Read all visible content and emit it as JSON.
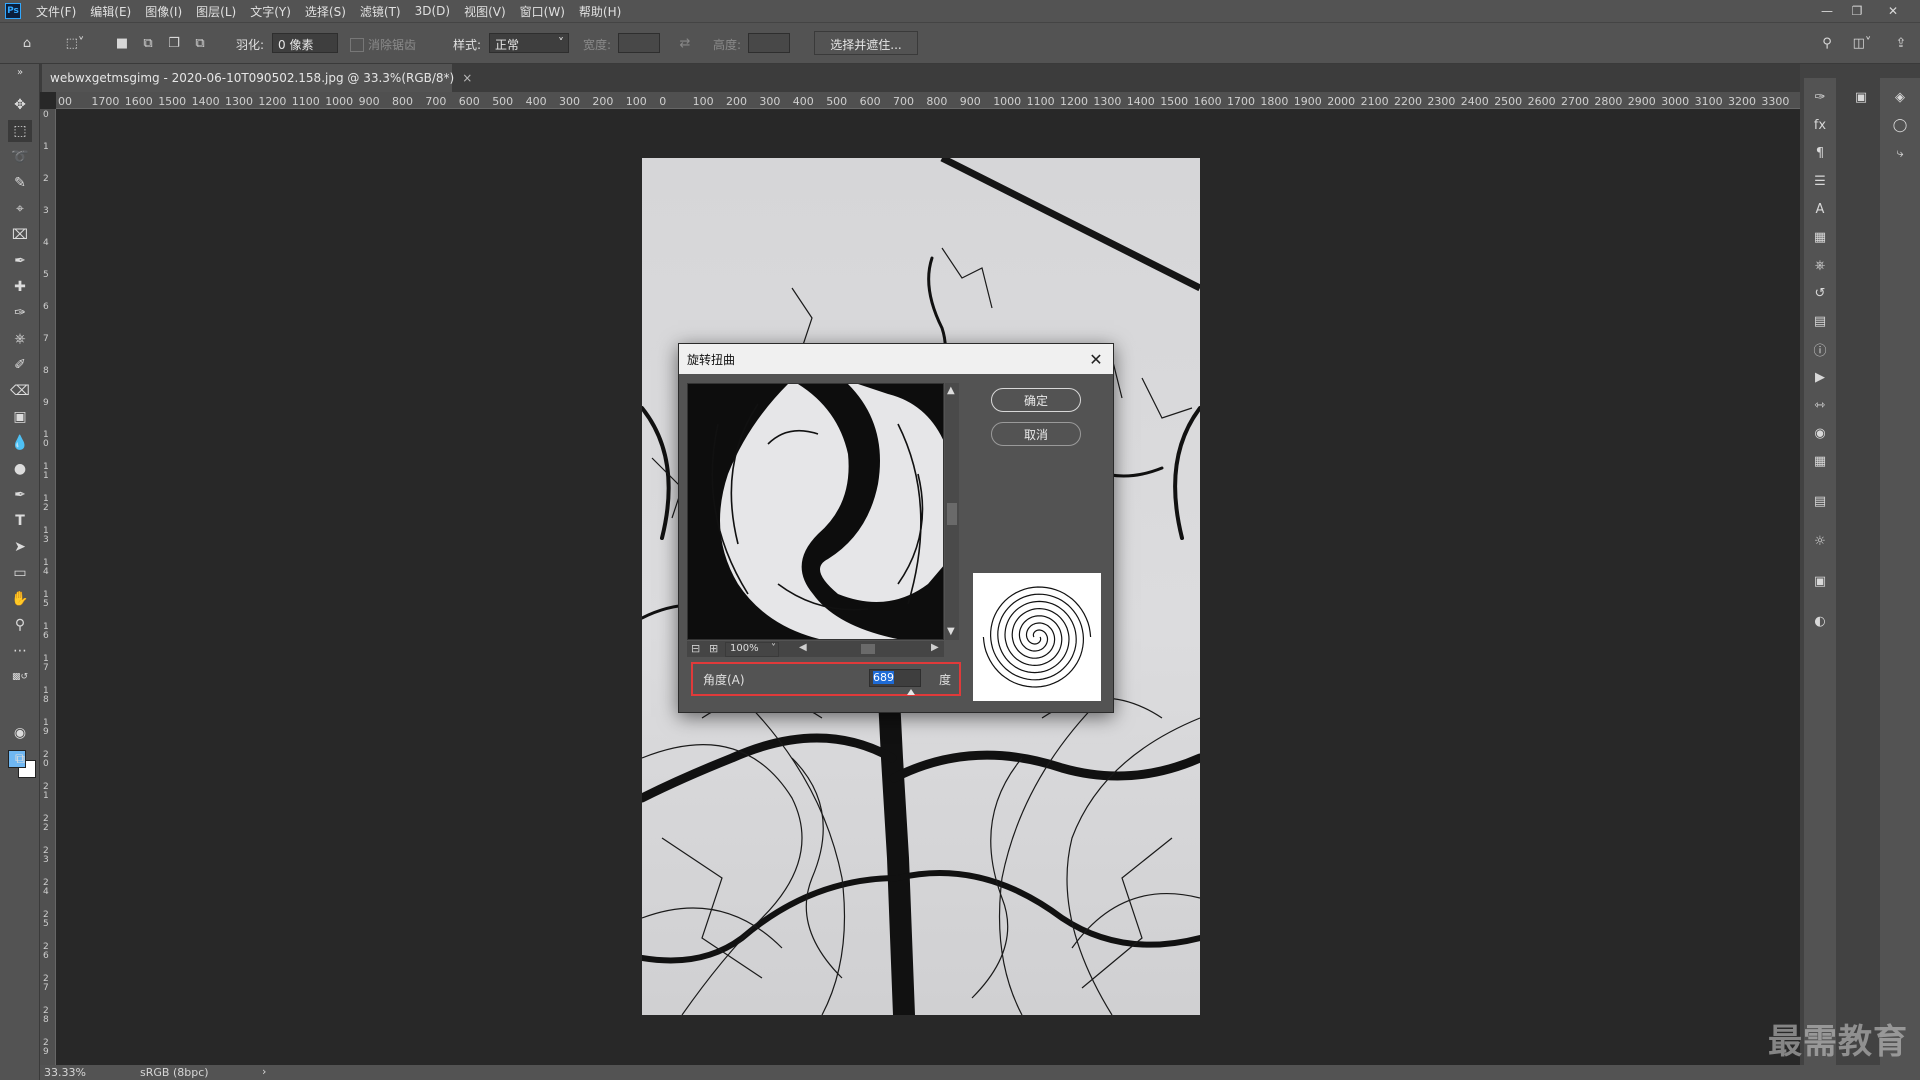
{
  "menubar": {
    "logo": "Ps",
    "items": [
      "文件(F)",
      "编辑(E)",
      "图像(I)",
      "图层(L)",
      "文字(Y)",
      "选择(S)",
      "滤镜(T)",
      "3D(D)",
      "视图(V)",
      "窗口(W)",
      "帮助(H)"
    ]
  },
  "optionsbar": {
    "feather_label": "羽化:",
    "feather_value": "0 像素",
    "antialias_label": "消除锯齿",
    "style_label": "样式:",
    "style_value": "正常",
    "width_label": "宽度:",
    "height_label": "高度:",
    "select_mask_label": "选择并遮住..."
  },
  "document": {
    "tab_title": "webwxgetmsgimg - 2020-06-10T090502.158.jpg @ 33.3%(RGB/8*)",
    "tab_close": "×"
  },
  "ruler": {
    "h_ticks": [
      "00",
      "1700",
      "1600",
      "1500",
      "1400",
      "1300",
      "1200",
      "1100",
      "1000",
      "900",
      "800",
      "700",
      "600",
      "500",
      "400",
      "300",
      "200",
      "100",
      "0",
      "100",
      "200",
      "300",
      "400",
      "500",
      "600",
      "700",
      "800",
      "900",
      "1000",
      "1100",
      "1200",
      "1300",
      "1400",
      "1500",
      "1600",
      "1700",
      "1800",
      "1900",
      "2000",
      "2100",
      "2200",
      "2300",
      "2400",
      "2500",
      "2600",
      "2700",
      "2800",
      "2900",
      "3000",
      "3100",
      "3200",
      "3300"
    ],
    "v_ticks": [
      "0",
      "1",
      "2",
      "3",
      "4",
      "5",
      "6",
      "7",
      "8",
      "9",
      "1 0",
      "1 1",
      "1 2",
      "1 3",
      "1 4",
      "1 5",
      "1 6",
      "1 7",
      "1 8",
      "1 9",
      "2 0",
      "2 1",
      "2 2",
      "2 3",
      "2 4",
      "2 5",
      "2 6",
      "2 7",
      "2 8",
      "2 9"
    ]
  },
  "dialog": {
    "title": "旋转扭曲",
    "ok_label": "确定",
    "cancel_label": "取消",
    "zoom_value": "100%",
    "angle_label": "角度(A)",
    "angle_value": "689",
    "angle_unit": "度"
  },
  "statusbar": {
    "zoom": "33.33%",
    "color_profile": "sRGB (8bpc)",
    "arrow": "›"
  },
  "watermark": "最需教育",
  "colors": {
    "ui_panel": "#535353",
    "canvas_bg": "#282828",
    "highlight_box": "#e03a3a",
    "selection": "#1e6bd6",
    "foreground_swatch": "#6fb7f2",
    "background_swatch": "#ffffff"
  }
}
